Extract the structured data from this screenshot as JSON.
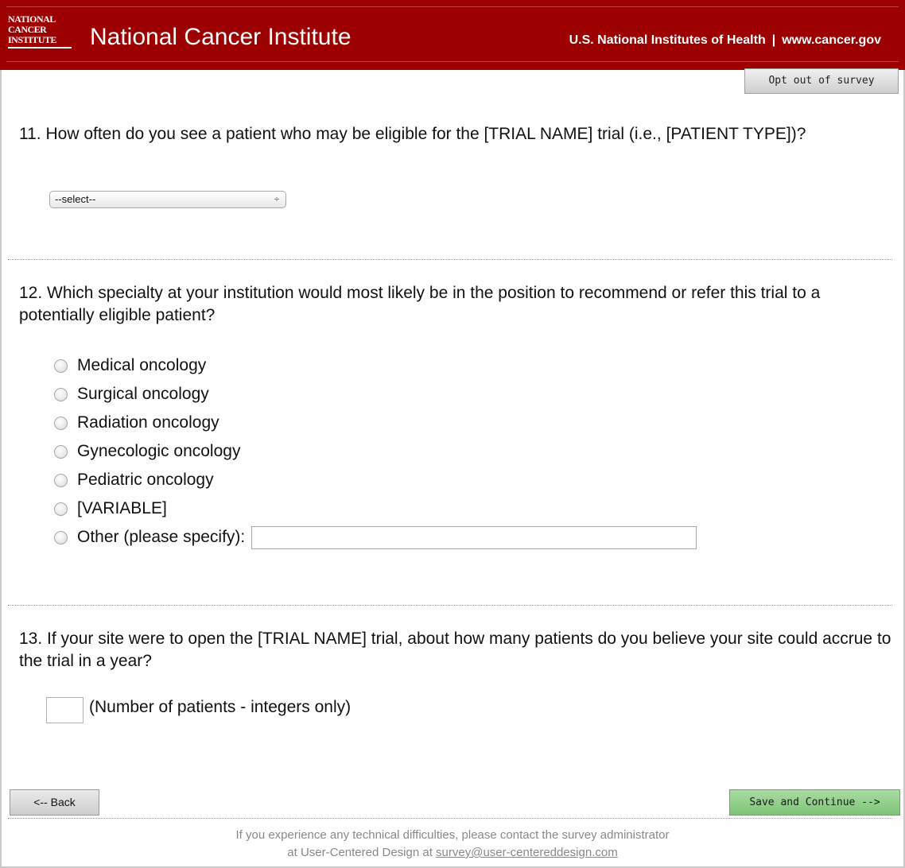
{
  "header": {
    "logo_lines": [
      "NATIONAL",
      "CANCER",
      "INSTITUTE"
    ],
    "site_title": "National Cancer Institute",
    "nih_link": "U.S. National Institutes of Health",
    "separator": "|",
    "gov_link": "www.cancer.gov"
  },
  "toolbar": {
    "opt_out_label": "Opt out of survey"
  },
  "q11": {
    "text": "11. How often do you see a patient who may be eligible for the [TRIAL NAME] trial (i.e., [PATIENT TYPE])?",
    "select_value": "--select--",
    "select_arrows": "÷"
  },
  "q12": {
    "text": "12. Which specialty at your institution would most likely be in the position to recommend or refer this trial to a potentially eligible patient?",
    "options": [
      "Medical oncology",
      "Surgical oncology",
      "Radiation oncology",
      "Gynecologic oncology",
      "Pediatric oncology",
      "[VARIABLE]",
      "Other (please specify):"
    ]
  },
  "q13": {
    "text": "13. If your site were to open the [TRIAL NAME] trial, about how many patients do you believe your site could accrue to the trial in a year?",
    "input_label": "(Number of patients - integers only)"
  },
  "nav": {
    "back_label": "<-- Back",
    "save_label": "Save and Continue -->"
  },
  "footer": {
    "line1": "If you experience any technical difficulties, please contact the survey administrator",
    "line2_prefix": "at User-Centered Design at ",
    "email": "survey@user-centereddesign.com"
  },
  "colors": {
    "header_bg": "#9c0000",
    "save_button": "#8fcf87"
  }
}
